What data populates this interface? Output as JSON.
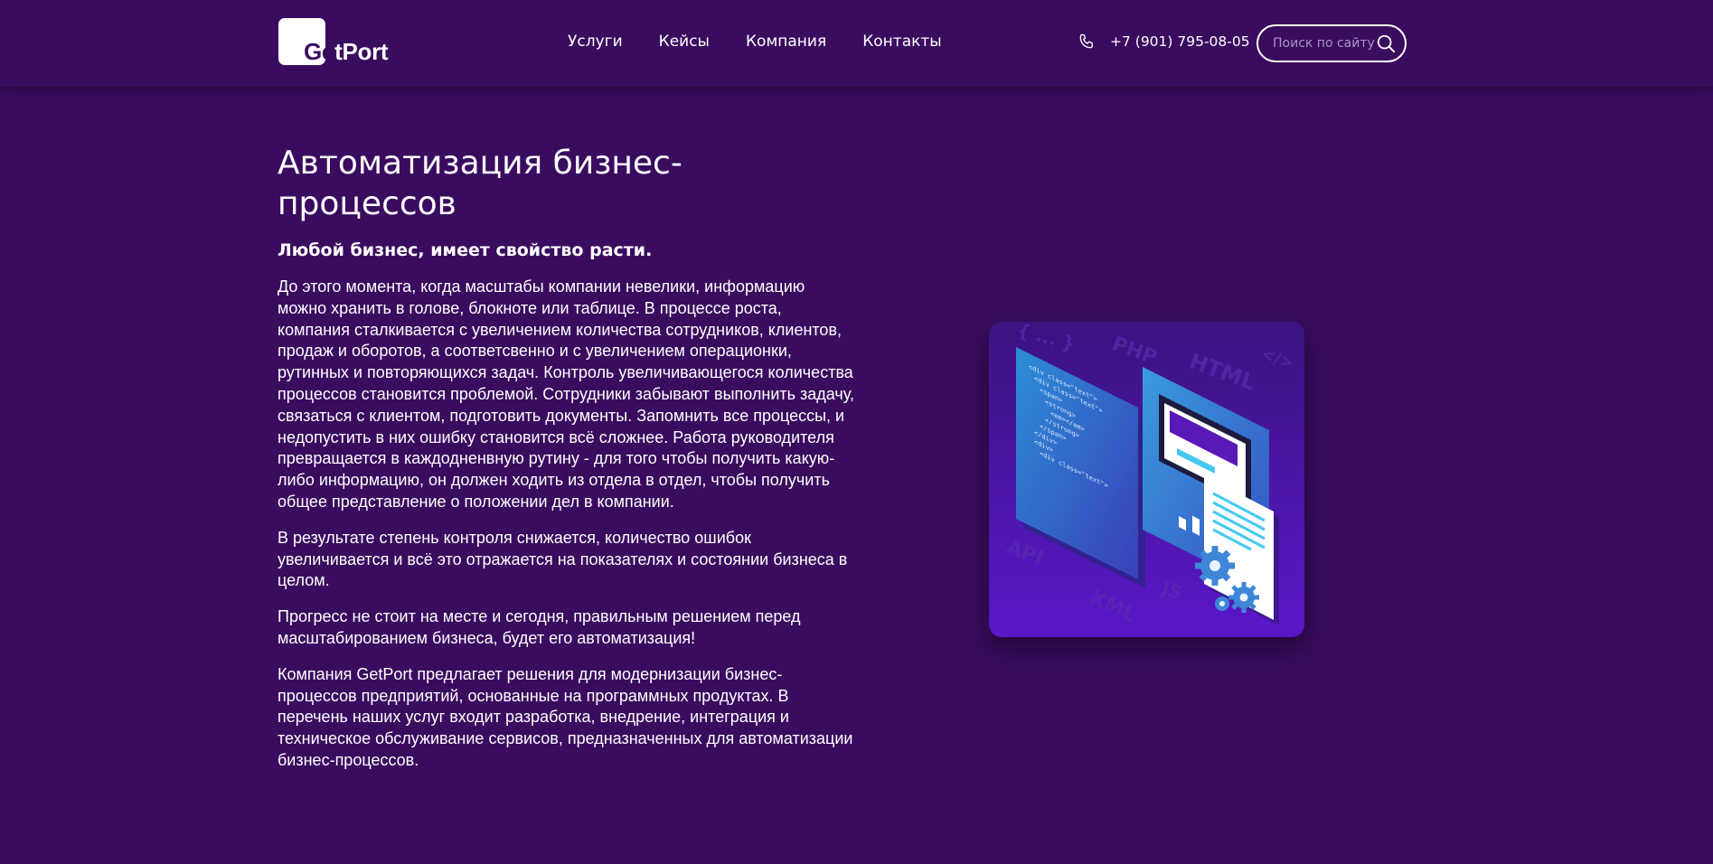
{
  "header": {
    "logo_text": "GetPort",
    "nav": [
      "Услуги",
      "Кейсы",
      "Компания",
      "Контакты"
    ],
    "phone": "+7 (901) 795-08-05",
    "search_placeholder": "Поиск по сайту"
  },
  "main": {
    "title": "Автоматизация бизнес-процессов",
    "subtitle": "Любой бизнес, имеет свойство расти.",
    "paragraphs": [
      "До этого момента, когда масштабы компании невелики, информацию можно хранить в голове, блокноте или таблице. В процессе роста, компания сталкивается с увеличением количества сотрудников, клиентов, продаж и оборотов, а соответсвенно и с увеличением операционки, рутинных и повторяющихся задач. Контроль увеличивающегося количества процессов становится проблемой. Сотрудники забывают выполнить задачу, связаться с клиентом, подготовить документы. Запомнить все процессы, и недопустить в них ошибку становится всё сложнее. Работа руководителя превращается в каждодненвную рутину - для того чтобы получить какую-либо информацию, он должен ходить из отдела в отдел, чтобы получить общее представление о положении дел в компании.",
      "В результате степень контроля снижается, количество ошибок увеличивается и всё это отражается на показателях и состоянии бизнеса в целом.",
      "Прогресс не стоит на месте и сегодня, правильным решением перед масштабированием бизнеса, будет его автоматизация!",
      "Компания GetPort предлагает решения для модернизации бизнес-процессов предприятий, основанные на программных продуктах. В перечень наших услуг входит разработка, внедрение, интеграция и техническое обслуживание сервисов, предназначенных для автоматизации бизнес-процессов."
    ]
  },
  "illustration": {
    "background_words": [
      "PHP",
      "HTML",
      "API",
      "XML",
      "JS",
      "{ ... }",
      "</>"
    ],
    "code_lines": [
      "<div class=\"text\">",
      "<div class=\"text\">",
      "<span>",
      "<strong>",
      "<em></em>",
      "</strong>",
      "</span>",
      "</div>",
      "<div>",
      "<div class=\"text\">"
    ]
  },
  "colors": {
    "background": "#3a0c5f",
    "text": "#ffffff",
    "accent": "#7b2ff0"
  },
  "icons": [
    "logo-mark-icon",
    "phone-icon",
    "search-icon"
  ]
}
